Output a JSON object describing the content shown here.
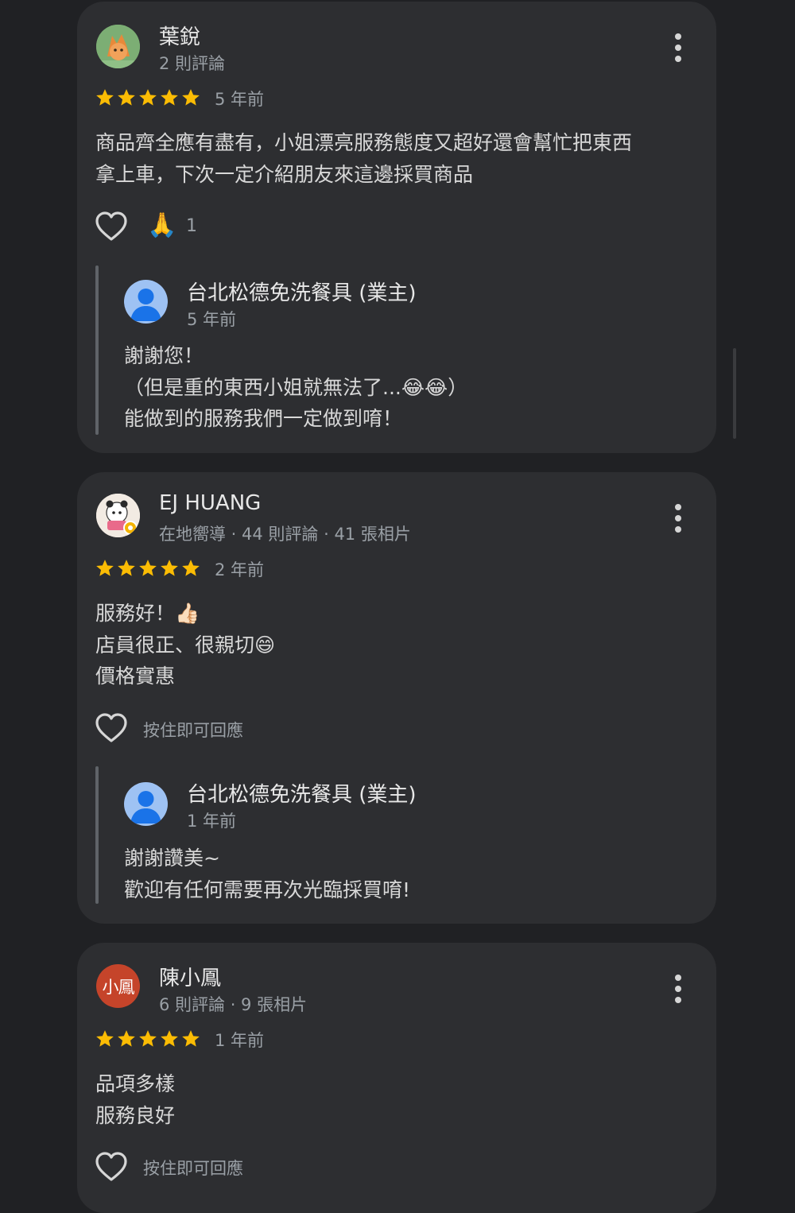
{
  "reviews": [
    {
      "author": "葉銳",
      "meta": "2 則評論",
      "rating": 5,
      "age": "5 年前",
      "text": [
        "商品齊全應有盡有，小姐漂亮服務態度又超好還會幫忙把東西",
        "拿上車，下次一定介紹朋友來這邊採買商品"
      ],
      "reaction_emoji": "🙏",
      "reaction_count": "1",
      "reply": {
        "owner": "台北松德免洗餐具 (業主)",
        "age": "5 年前",
        "text": [
          "謝謝您！",
          "（但是重的東西小姐就無法了...😂😂）",
          "能做到的服務我們一定做到唷！"
        ]
      }
    },
    {
      "author": "EJ HUANG",
      "meta": "在地嚮導 · 44 則評論 · 41 張相片",
      "rating": 5,
      "age": "2 年前",
      "text": [
        "服務好！👍🏻",
        "店員很正、很親切😄",
        "價格實惠"
      ],
      "hold_hint": "按住即可回應",
      "reply": {
        "owner": "台北松德免洗餐具 (業主)",
        "age": "1 年前",
        "text": [
          "謝謝讚美~",
          "歡迎有任何需要再次光臨採買唷!"
        ]
      }
    },
    {
      "author": "陳小鳳",
      "avatar_text": "小鳳",
      "meta": "6 則評論 · 9 張相片",
      "rating": 5,
      "age": "1 年前",
      "text": [
        "品項多樣",
        "服務良好"
      ],
      "hold_hint": "按住即可回應"
    }
  ],
  "colors": {
    "background": "#202124",
    "card": "#2d2e31",
    "star": "#fbbc04",
    "secondary_text": "#9aa0a6",
    "avatar_red": "#c5442a",
    "owner_avatar": "#9ec2f3"
  }
}
